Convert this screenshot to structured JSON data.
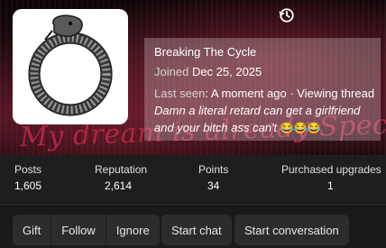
{
  "profile": {
    "username": "Breaking The Cycle",
    "joined_label": "Joined",
    "joined_date": "Dec 25, 2025",
    "last_seen_label": "Last seen",
    "last_seen_value": "A moment ago",
    "activity_prefix": "· Viewing thread",
    "thread_title": "Damn a literal retard can get a girlfriend and your bitch ass can't",
    "thread_emoji": "😂😂😂",
    "banner_script": "My dream is already Specified your self"
  },
  "stats": [
    {
      "label": "Posts",
      "value": "1,605"
    },
    {
      "label": "Reputation",
      "value": "2,614"
    },
    {
      "label": "Points",
      "value": "34"
    },
    {
      "label": "Purchased upgrades",
      "value": "1"
    }
  ],
  "actions": {
    "gift": "Gift",
    "follow": "Follow",
    "ignore": "Ignore",
    "start_chat": "Start chat",
    "start_conversation": "Start conversation"
  },
  "icons": {
    "edit": "history-icon",
    "avatar": "ouroboros-snake"
  }
}
